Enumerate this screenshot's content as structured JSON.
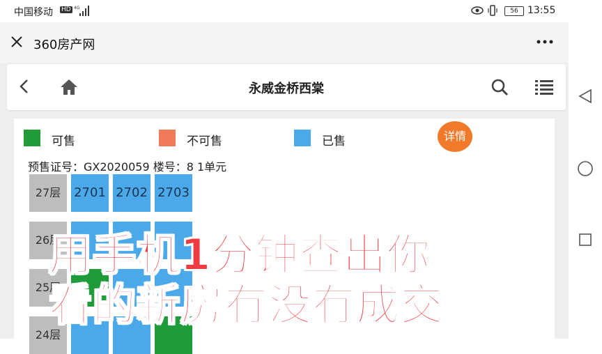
{
  "status_bar": {
    "carrier": "中国移动",
    "hd_badge": "HD",
    "network": "4G",
    "battery": "56",
    "time": "13:55",
    "icons": [
      "signal-icon",
      "eye-icon",
      "vibrate-icon",
      "battery-icon"
    ]
  },
  "app_bar": {
    "title": "360房产网",
    "close_icon": "close-icon",
    "more_icon": "more-icon"
  },
  "site_header": {
    "title": "永威金桥西棠",
    "icons": [
      "back-icon",
      "home-icon",
      "search-icon",
      "menu-icon"
    ]
  },
  "legend": [
    {
      "label": "可售",
      "color": "#1f9b3a"
    },
    {
      "label": "不可售",
      "color": "#f07a5a"
    },
    {
      "label": "已售",
      "color": "#4ba9ea"
    }
  ],
  "detail_button": "详情",
  "permit_line": "预售证号：GX2020059 楼号：8 1单元",
  "floors": [
    {
      "label": "27层",
      "units": [
        {
          "no": "2701",
          "status": "sold"
        },
        {
          "no": "2702",
          "status": "sold"
        },
        {
          "no": "2703",
          "status": "sold"
        }
      ]
    },
    {
      "label": "26层",
      "units": [
        {
          "no": "",
          "status": "sold"
        },
        {
          "no": "",
          "status": "sold"
        },
        {
          "no": "",
          "status": "sold"
        }
      ]
    },
    {
      "label": "25层",
      "units": [
        {
          "no": "",
          "status": "available"
        },
        {
          "no": "",
          "status": "sold"
        },
        {
          "no": "",
          "status": "sold"
        }
      ]
    },
    {
      "label": "24层",
      "units": [
        {
          "no": "",
          "status": "sold"
        },
        {
          "no": "",
          "status": "sold"
        },
        {
          "no": "",
          "status": "available"
        }
      ]
    }
  ],
  "overlay_text": {
    "line1": "用手机1分钟查出你",
    "line2": "看的新房有没有成交"
  },
  "colors": {
    "accent_orange": "#f07a2a",
    "sold_blue": "#4ba9ea",
    "available_green": "#1f9b3a",
    "overlay_red": "#ee3a41"
  },
  "system_nav": [
    "back-nav-icon",
    "home-nav-icon",
    "recent-apps-icon"
  ]
}
